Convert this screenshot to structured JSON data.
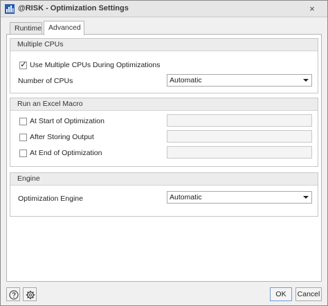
{
  "window": {
    "title": "@RISK - Optimization Settings",
    "close_glyph": "×"
  },
  "tabs": [
    {
      "label": "Runtime",
      "active": false
    },
    {
      "label": "Advanced",
      "active": true
    }
  ],
  "multiple_cpus": {
    "header": "Multiple CPUs",
    "use_multiple_label": "Use Multiple CPUs During Optimizations",
    "use_multiple_checked": true,
    "num_cpus_label": "Number of CPUs",
    "num_cpus_value": "Automatic"
  },
  "excel_macro": {
    "header": "Run an Excel Macro",
    "items": [
      {
        "label": "At Start of Optimization",
        "checked": false,
        "value": ""
      },
      {
        "label": "After Storing Output",
        "checked": false,
        "value": ""
      },
      {
        "label": "At End of Optimization",
        "checked": false,
        "value": ""
      }
    ]
  },
  "engine": {
    "header": "Engine",
    "label": "Optimization Engine",
    "value": "Automatic"
  },
  "footer": {
    "help_icon": "help-icon",
    "settings_icon": "gear-icon",
    "ok_label": "OK",
    "cancel_label": "Cancel"
  },
  "colors": {
    "app_icon": "#2a5db0",
    "accent_border": "#6f9fd8"
  }
}
